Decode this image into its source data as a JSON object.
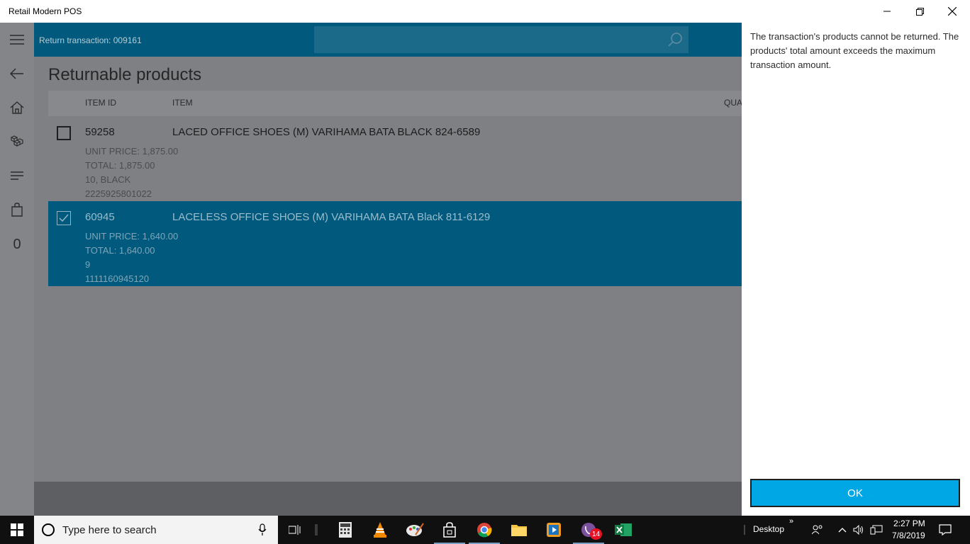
{
  "window": {
    "title": "Retail Modern POS"
  },
  "rail": {
    "cart_count": "0"
  },
  "appbar": {
    "return_transaction": "Return transaction: 009161",
    "search_placeholder": ""
  },
  "page": {
    "title": "Returnable products",
    "columns": {
      "item_id": "ITEM ID",
      "item": "ITEM",
      "quantity": "QUA"
    },
    "rows": [
      {
        "checked": false,
        "item_id": "59258",
        "item": "LACED OFFICE SHOES (M) VARIHAMA BATA BLACK 824-6589",
        "unit_price": "UNIT PRICE: 1,875.00",
        "total": "TOTAL: 1,875.00",
        "variant": "10, BLACK",
        "barcode": "2225925801022"
      },
      {
        "checked": true,
        "item_id": "60945",
        "item": "LACELESS OFFICE SHOES (M) VARIHAMA BATA Black 811-6129",
        "unit_price": "UNIT PRICE: 1,640.00",
        "total": "TOTAL: 1,640.00",
        "variant": "9",
        "barcode": "1111160945120"
      }
    ]
  },
  "dialog": {
    "message": "The transaction's products cannot be returned. The products' total amount exceeds the maximum transaction amount.",
    "ok_label": "OK"
  },
  "taskbar": {
    "search_placeholder": "Type here to search",
    "viber_badge": "14",
    "desktop_label": "Desktop",
    "time": "2:27 PM",
    "date": "7/8/2019"
  },
  "colors": {
    "accent": "#015a7d",
    "ok_button": "#00a7e5",
    "overlay_gray": "#7e8083"
  }
}
